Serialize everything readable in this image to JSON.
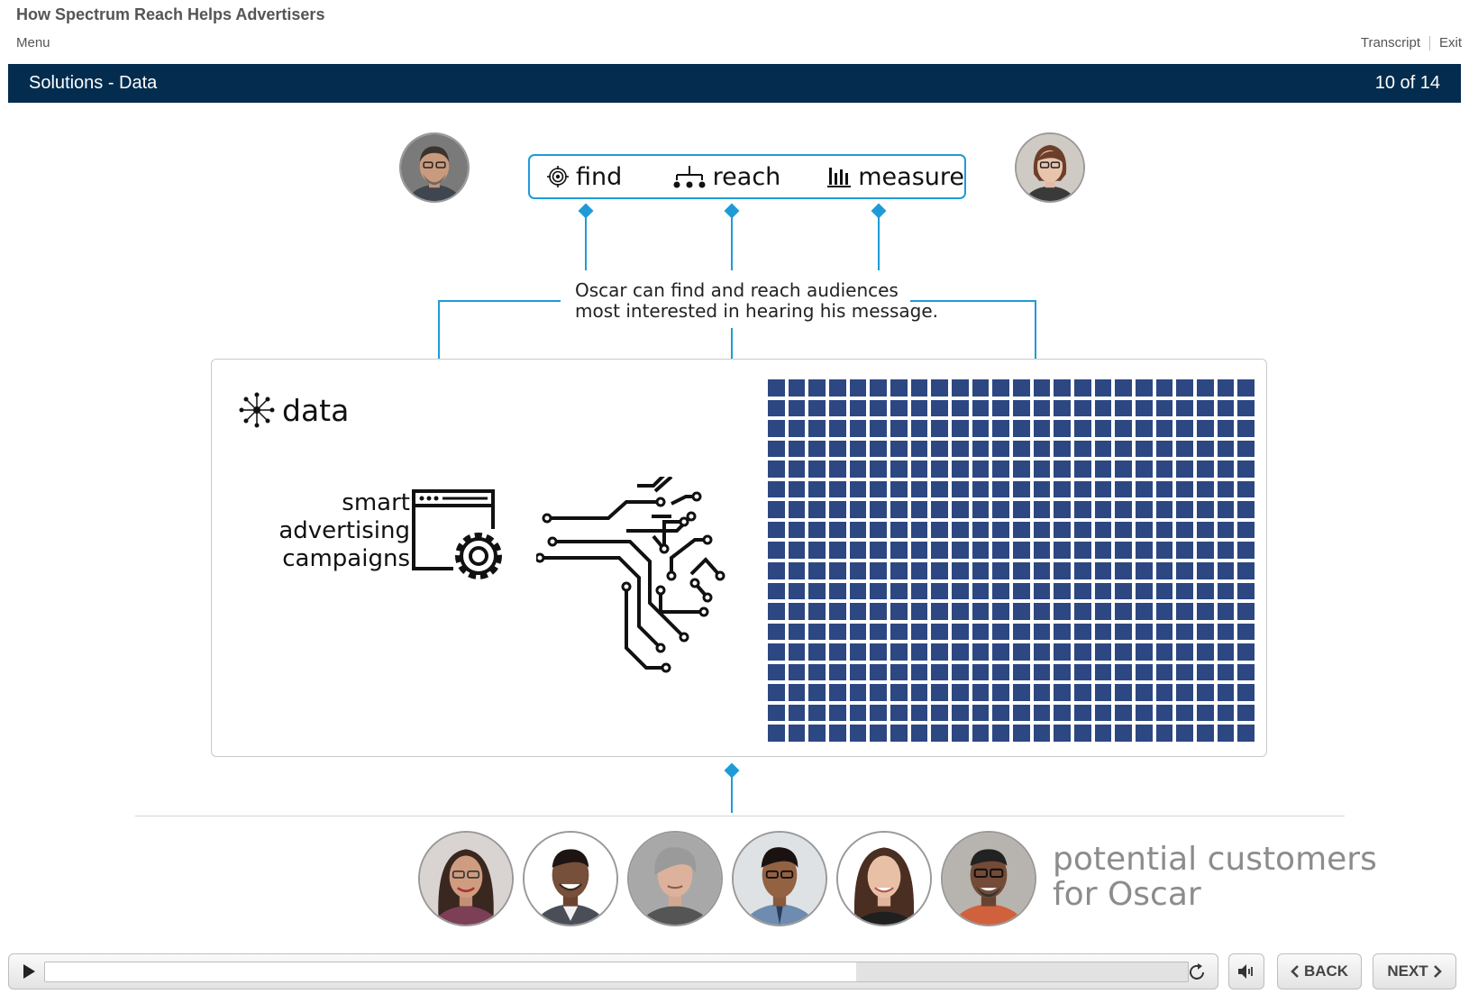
{
  "header": {
    "course_title": "How Spectrum Reach Helps Advertisers",
    "menu_label": "Menu",
    "transcript_label": "Transcript",
    "exit_label": "Exit"
  },
  "title_bar": {
    "slide_title": "Solutions - Data",
    "slide_counter": "10 of 14"
  },
  "find_reach_measure": {
    "find_label": "find",
    "reach_label": "reach",
    "measure_label": "measure"
  },
  "caption": {
    "line1": "Oscar can find and reach audiences",
    "line2": "most interested in hearing his message."
  },
  "data_panel": {
    "title": "data",
    "smart_line1": "smart",
    "smart_line2": "advertising",
    "smart_line3": "campaigns"
  },
  "customers": {
    "label_line1": "potential customers",
    "label_line2": "for Oscar"
  },
  "player": {
    "progress": 0.71,
    "back_label": "BACK",
    "next_label": "NEXT"
  },
  "icons": [
    "play-icon",
    "replay-icon",
    "volume-icon",
    "chevron-left-icon",
    "chevron-right-icon",
    "target-icon",
    "network-icon",
    "bar-chart-icon",
    "data-burst-icon",
    "browser-gear-icon",
    "circuit-brain-icon"
  ],
  "colors": {
    "title_bar": "#032c4e",
    "accent": "#1e9bd7",
    "grid": "#2c4782"
  }
}
